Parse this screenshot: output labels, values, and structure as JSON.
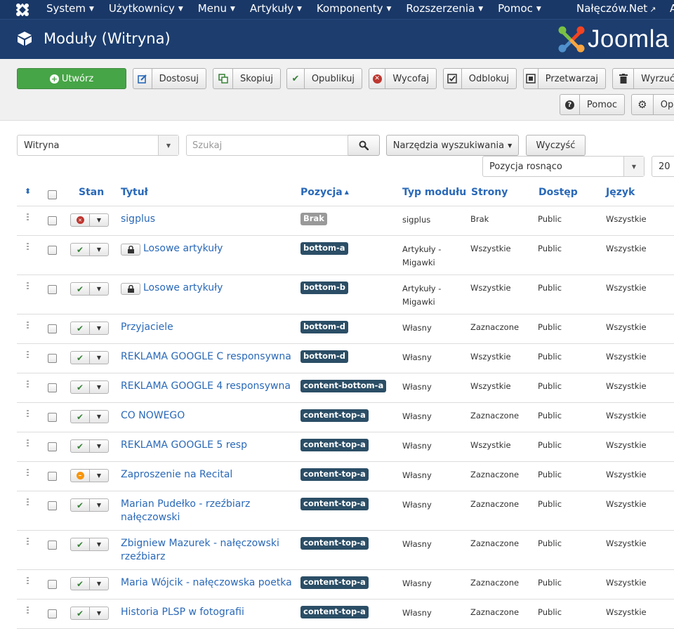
{
  "topnav": {
    "menu": [
      "System",
      "Użytkownicy",
      "Menu",
      "Artykuły",
      "Komponenty",
      "Rozszerzenia",
      "Pomoc"
    ],
    "site_link": "Nałęczów.Net",
    "cut_text": "A"
  },
  "header": {
    "title": "Moduły (Witryna)",
    "brand": "Joomla"
  },
  "toolbar": {
    "new": "Utwórz",
    "edit": "Dostosuj",
    "copy": "Skopiuj",
    "publish": "Opublikuj",
    "unpublish": "Wycofaj",
    "checkin": "Odblokuj",
    "batch": "Przetwarzaj",
    "trash": "Wyrzuć",
    "help": "Pomoc",
    "options": "Opcje"
  },
  "filters": {
    "client": "Witryna",
    "search_placeholder": "Szukaj",
    "search_tools": "Narzędzia wyszukiwania",
    "clear": "Wyczyść",
    "ordering": "Pozycja rosnąco",
    "limit": "20"
  },
  "columns": {
    "status": "Stan",
    "title": "Tytuł",
    "position": "Pozycja",
    "type": "Typ modułu",
    "pages": "Strony",
    "access": "Dostęp",
    "language": "Język"
  },
  "rows": [
    {
      "status": "unpublished",
      "locked": false,
      "title": "sigplus",
      "position": "Brak",
      "type": "sigplus",
      "pages": "Brak",
      "access": "Public",
      "language": "Wszystkie"
    },
    {
      "status": "published",
      "locked": true,
      "title": "Losowe artykuły",
      "position": "bottom-a",
      "type": "Artykuły - Migawki",
      "pages": "Wszystkie",
      "access": "Public",
      "language": "Wszystkie"
    },
    {
      "status": "published",
      "locked": true,
      "title": "Losowe artykuły",
      "position": "bottom-b",
      "type": "Artykuły - Migawki",
      "pages": "Wszystkie",
      "access": "Public",
      "language": "Wszystkie"
    },
    {
      "status": "published",
      "locked": false,
      "title": "Przyjaciele",
      "position": "bottom-d",
      "type": "Własny",
      "pages": "Zaznaczone",
      "access": "Public",
      "language": "Wszystkie"
    },
    {
      "status": "published",
      "locked": false,
      "title": "REKLAMA GOOGLE C responsywna",
      "position": "bottom-d",
      "type": "Własny",
      "pages": "Wszystkie",
      "access": "Public",
      "language": "Wszystkie"
    },
    {
      "status": "published",
      "locked": false,
      "title": "REKLAMA GOOGLE 4 responsywna",
      "position": "content-bottom-a",
      "type": "Własny",
      "pages": "Wszystkie",
      "access": "Public",
      "language": "Wszystkie"
    },
    {
      "status": "published",
      "locked": false,
      "title": "CO NOWEGO",
      "position": "content-top-a",
      "type": "Własny",
      "pages": "Zaznaczone",
      "access": "Public",
      "language": "Wszystkie"
    },
    {
      "status": "published",
      "locked": false,
      "title": "REKLAMA GOOGLE 5 resp",
      "position": "content-top-a",
      "type": "Własny",
      "pages": "Wszystkie",
      "access": "Public",
      "language": "Wszystkie"
    },
    {
      "status": "expired",
      "locked": false,
      "title": "Zaproszenie na Recital",
      "position": "content-top-a",
      "type": "Własny",
      "pages": "Zaznaczone",
      "access": "Public",
      "language": "Wszystkie"
    },
    {
      "status": "published",
      "locked": false,
      "title": "Marian Pudełko - rzeźbiarz nałęczowski",
      "position": "content-top-a",
      "type": "Własny",
      "pages": "Zaznaczone",
      "access": "Public",
      "language": "Wszystkie"
    },
    {
      "status": "published",
      "locked": false,
      "title": "Zbigniew Mazurek - nałęczowski rzeźbiarz",
      "position": "content-top-a",
      "type": "Własny",
      "pages": "Zaznaczone",
      "access": "Public",
      "language": "Wszystkie"
    },
    {
      "status": "published",
      "locked": false,
      "title": "Maria Wójcik - nałęczowska poetka",
      "position": "content-top-a",
      "type": "Własny",
      "pages": "Zaznaczone",
      "access": "Public",
      "language": "Wszystkie"
    },
    {
      "status": "published",
      "locked": false,
      "title": "Historia PLSP w fotografii",
      "position": "content-top-a",
      "type": "Własny",
      "pages": "Zaznaczone",
      "access": "Public",
      "language": "Wszystkie"
    }
  ],
  "colors": {
    "topnav_bg": "#1a3867",
    "header_bg": "#1c3d6e",
    "link": "#2a69b8",
    "new_button": "#46a546",
    "position_badge": "#2b4e66",
    "published": "#378137",
    "unpublished": "#bd362f",
    "expired": "#f89406"
  }
}
